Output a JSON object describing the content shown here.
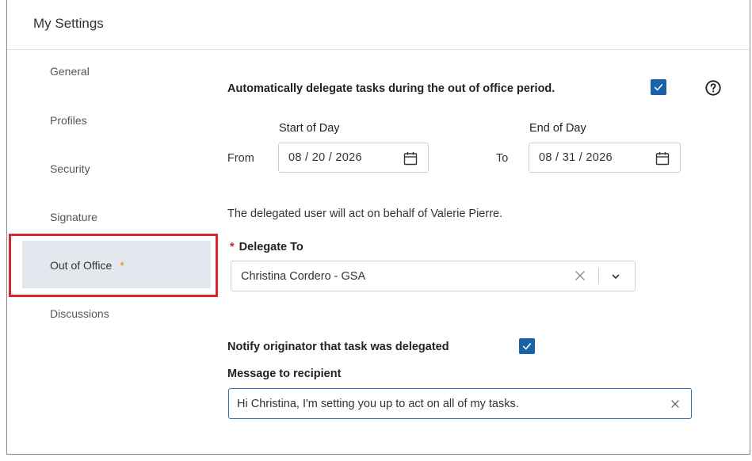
{
  "header": {
    "title": "My Settings"
  },
  "sidebar": {
    "items": [
      {
        "label": "General"
      },
      {
        "label": "Profiles"
      },
      {
        "label": "Security"
      },
      {
        "label": "Signature"
      },
      {
        "label": "Out of Office",
        "marker": "*",
        "selected": true
      },
      {
        "label": "Discussions"
      }
    ]
  },
  "out_of_office": {
    "auto_delegate_label": "Automatically delegate tasks during the out of office period.",
    "auto_delegate_checked": true,
    "start_label": "Start of Day",
    "end_label": "End of Day",
    "from_label": "From",
    "to_label": "To",
    "start_date": "08 / 20 / 2026",
    "end_date": "08 / 31 / 2026",
    "info_text": "The delegated user will act on behalf of Valerie Pierre.",
    "delegate_required_marker": "*",
    "delegate_label": "Delegate To",
    "delegate_value": "Christina Cordero - GSA",
    "notify_label": "Notify originator that task was delegated",
    "notify_checked": true,
    "message_label": "Message to recipient",
    "message_value": "Hi Christina, I'm setting you up to act on all of my tasks."
  },
  "icons": {
    "help": "help-circle-icon",
    "calendar": "calendar-icon",
    "clear": "close-icon",
    "dropdown": "chevron-down-icon",
    "checkmark": "check-icon"
  },
  "colors": {
    "accent": "#1a62a8",
    "selected_bg": "#e2e8ee",
    "highlight_border": "#d8262b",
    "required": "#d0232b",
    "star": "#e68a00"
  }
}
